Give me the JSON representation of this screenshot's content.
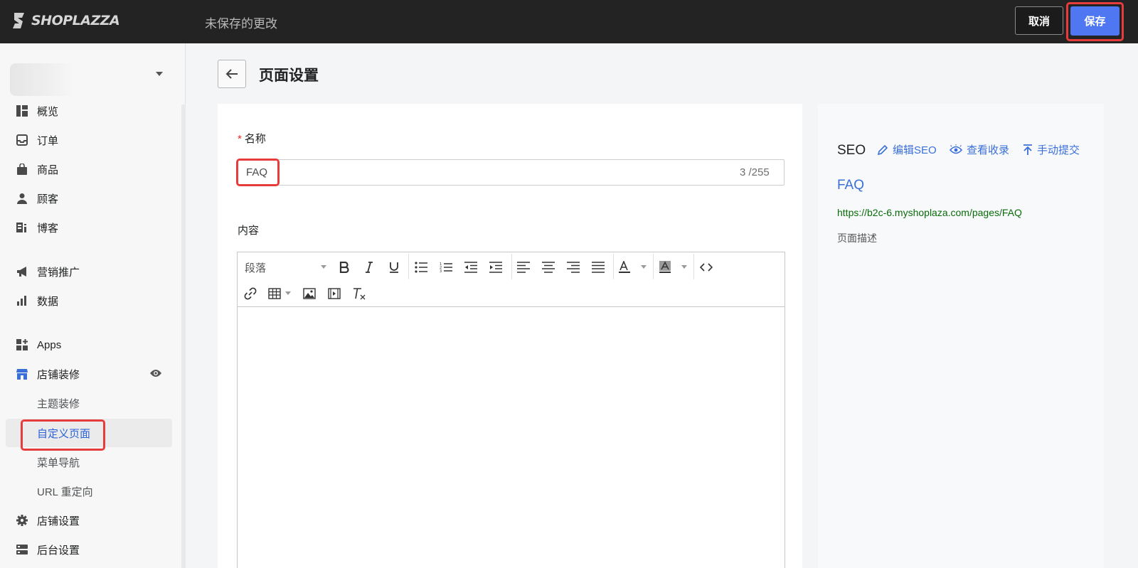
{
  "topbar": {
    "logo_text": "SHOPLAZZA",
    "unsaved_text": "未保存的更改",
    "cancel_label": "取消",
    "save_label": "保存"
  },
  "sidebar": {
    "items": [
      {
        "label": "概览",
        "icon": "dashboard-icon"
      },
      {
        "label": "订单",
        "icon": "inbox-icon"
      },
      {
        "label": "商品",
        "icon": "bag-icon"
      },
      {
        "label": "顾客",
        "icon": "person-icon"
      },
      {
        "label": "博客",
        "icon": "blog-icon"
      },
      {
        "label": "营销推广",
        "icon": "megaphone-icon"
      },
      {
        "label": "数据",
        "icon": "bar-chart-icon"
      },
      {
        "label": "Apps",
        "icon": "apps-icon"
      },
      {
        "label": "店铺装修",
        "icon": "store-icon"
      },
      {
        "label": "主题装修"
      },
      {
        "label": "自定义页面"
      },
      {
        "label": "菜单导航"
      },
      {
        "label": "URL 重定向"
      },
      {
        "label": "店铺设置",
        "icon": "gear-icon"
      },
      {
        "label": "后台设置",
        "icon": "server-icon"
      }
    ]
  },
  "page": {
    "title": "页面设置",
    "name_label": "名称",
    "name_value": "FAQ",
    "name_counter": "3 /255",
    "content_label": "内容",
    "paragraph_select": "段落"
  },
  "seo": {
    "title": "SEO",
    "edit_label": "编辑SEO",
    "view_label": "查看收录",
    "submit_label": "手动提交",
    "page_title": "FAQ",
    "url": "https://b2c-6.myshoplaza.com/pages/FAQ",
    "description": "页面描述"
  },
  "colors": {
    "accent": "#4e77f1",
    "link": "#3a6fd8",
    "highlight": "#e63c3c"
  }
}
